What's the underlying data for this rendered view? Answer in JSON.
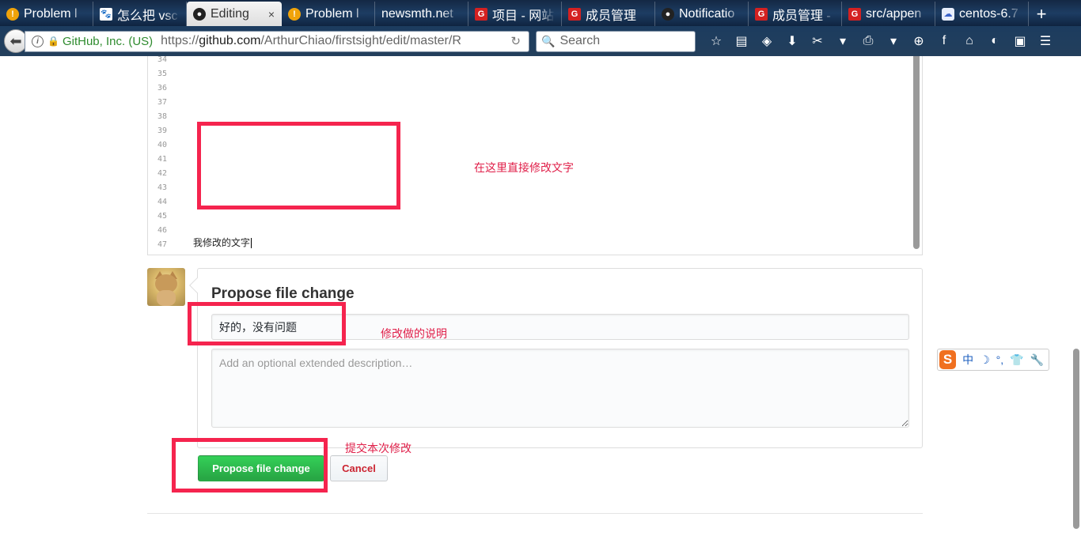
{
  "browser": {
    "tabs": [
      {
        "label": "Problem l",
        "icon": "warning-icon",
        "active": false
      },
      {
        "label": "怎么把 vsc",
        "icon": "paw-icon",
        "active": false
      },
      {
        "label": "Editing",
        "icon": "github-icon",
        "active": true,
        "close": "×"
      },
      {
        "label": "Problem l",
        "icon": "warning-icon",
        "active": false
      },
      {
        "label": "newsmth.net",
        "icon": "",
        "active": false
      },
      {
        "label": "项目 - 网站",
        "icon": "gitee-icon",
        "active": false
      },
      {
        "label": "成员管理",
        "icon": "gitee-icon",
        "active": false
      },
      {
        "label": "Notificatio",
        "icon": "github-icon",
        "active": false
      },
      {
        "label": "成员管理 -",
        "icon": "gitee-icon",
        "active": false
      },
      {
        "label": "src/appen",
        "icon": "gitee-icon",
        "active": false
      },
      {
        "label": "centos-6.7",
        "icon": "cloud-icon",
        "active": false
      }
    ],
    "new_tab": "+",
    "site_identity": "GitHub, Inc. (US)",
    "url_prefix": "https://",
    "url_host": "github.com",
    "url_path": "/ArthurChiao/firstsight/edit/master/R",
    "search_placeholder": "Search"
  },
  "editor": {
    "line_numbers": [
      "34",
      "35",
      "36",
      "37",
      "38",
      "39",
      "40",
      "41",
      "42",
      "43",
      "44",
      "45",
      "46",
      "47"
    ],
    "current_line_text": "我修改的文字"
  },
  "commit_form": {
    "title": "Propose file change",
    "summary_value": "好的，没有问题",
    "description_placeholder": "Add an optional extended description…",
    "submit_label": "Propose file change",
    "cancel_label": "Cancel"
  },
  "annotations": {
    "edit_text": "在这里直接修改文字",
    "summary_text": "修改做的说明",
    "submit_text": "提交本次修改",
    "color": "#f5244e"
  },
  "ime": {
    "logo": "S",
    "mode": "中",
    "moon": "☽",
    "punct": "°,",
    "shirt": "👕",
    "wrench": "🔧"
  },
  "colors": {
    "primary_button": "#28a745",
    "cancel_text": "#cb2431",
    "link": "#4078c0"
  }
}
